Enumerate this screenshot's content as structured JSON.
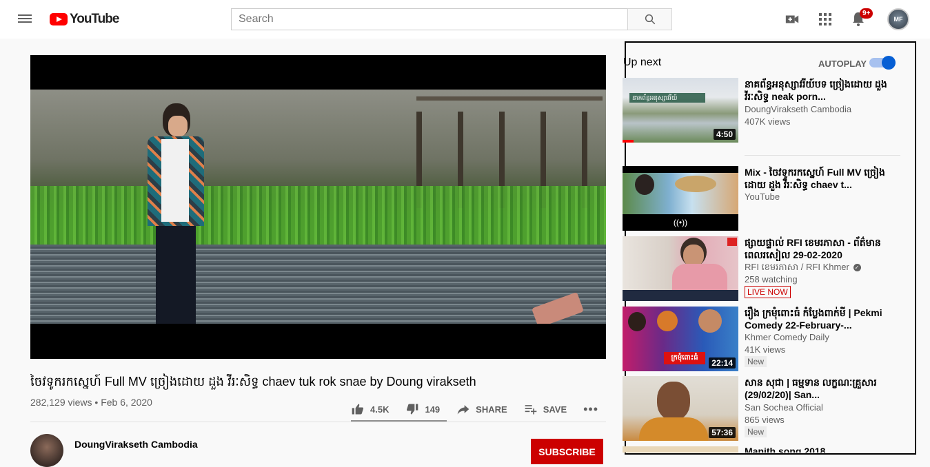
{
  "header": {
    "logo_text": "YouTube",
    "search_placeholder": "Search",
    "notification_count": "9+",
    "avatar_initials": "MF"
  },
  "video": {
    "title": "ចៃវទូករកស្នេហ៍ Full MV ច្រៀងដោយ ដួង វីរៈសិទ្ធ chaev tuk rok snae by Doung virakseth",
    "views": "282,129 views",
    "date": "Feb 6, 2020",
    "likes": "4.5K",
    "dislikes": "149",
    "share_label": "SHARE",
    "save_label": "SAVE",
    "sentiment_ratio": 0.968
  },
  "channel": {
    "name": "DoungVirakseth Cambodia",
    "subscribe_label": "SUBSCRIBE"
  },
  "sidebar": {
    "up_next_label": "Up next",
    "autoplay_label": "AUTOPLAY",
    "autoplay_on": true,
    "items": [
      {
        "title": "នាគព័ន្ធអនុស្សាវរីយ៍បទ ច្រៀងដោយ ដួង វីរៈសិទ្ធ neak porn...",
        "channel": "DoungVirakseth Cambodia",
        "views": "407K views",
        "duration": "4:50",
        "thumb_text": "នាគព័ន្ធអនុស្សាវរីយ៍"
      },
      {
        "title": "Mix - ចៃវទូករកស្នេហ៍ Full MV ច្រៀងដោយ ដួង វីរៈសិទ្ធ chaev t...",
        "channel": "YouTube",
        "mix_icon": "((•))"
      },
      {
        "title": "ផ្សាយផ្ទាល់ RFI ខេមរភាសា - ព័ត៌មានពេលរសៀល 29-02-2020",
        "channel": "RFI ខេមរភាសា / RFI Khmer",
        "views": "258 watching",
        "live_label": "LIVE NOW"
      },
      {
        "title": "រឿង ក្រមុំពោះធំ កំប្លែងពាក់មី | Pekmi Comedy 22-February-...",
        "channel": "Khmer Comedy Daily",
        "views": "41K views",
        "duration": "22:14",
        "new_label": "New",
        "thumb_text": "ក្រមុំពោះធំ"
      },
      {
        "title": "សាន សុជា | ធម្មទាន លក្ខណៈគ្រួសារ (29/02/20)| San...",
        "channel": "San Sochea Official",
        "views": "865 views",
        "duration": "57:36",
        "new_label": "New"
      },
      {
        "title": "Manith song 2018"
      }
    ]
  }
}
